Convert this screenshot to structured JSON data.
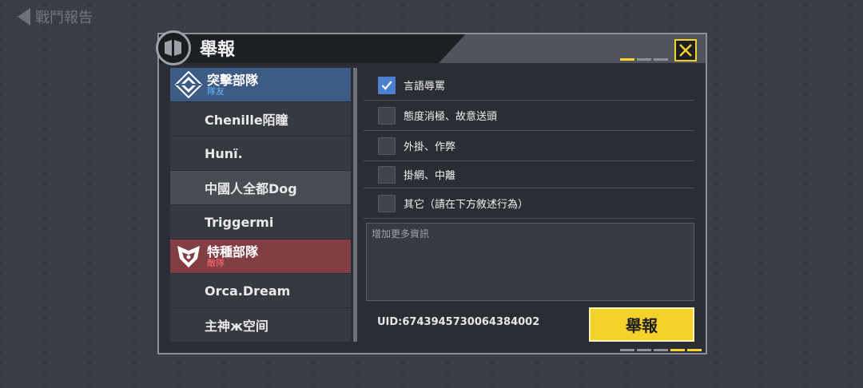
{
  "top_bar": {
    "back_title": "戰鬥報告"
  },
  "dialog": {
    "title": "舉報"
  },
  "teams": [
    {
      "name": "突擊部隊",
      "role": "隊友",
      "players": [
        "Chenille陌瞳",
        "Hunï.",
        "中國人全都Dog",
        "Triggermi"
      ]
    },
    {
      "name": "特種部隊",
      "role": "敵隊",
      "players": [
        "Orca.Dream",
        "主神ж空间"
      ]
    }
  ],
  "selected_player": "中國人全都Dog",
  "reasons": [
    {
      "label": "言語辱罵",
      "checked": true
    },
    {
      "label": "態度消極、故意送頭",
      "checked": false
    },
    {
      "label": "外掛、作弊",
      "checked": false
    },
    {
      "label": "掛網、中離",
      "checked": false
    },
    {
      "label": "其它（請在下方敘述行為）",
      "checked": false
    }
  ],
  "more_info": {
    "placeholder": "增加更多資訊",
    "value": ""
  },
  "uid": "UID:6743945730064384002",
  "report_button": "舉報",
  "colors": {
    "accent": "#f4d22b",
    "ally": "#3e5b85",
    "enemy": "#833e44",
    "check": "#4b7fd0"
  }
}
